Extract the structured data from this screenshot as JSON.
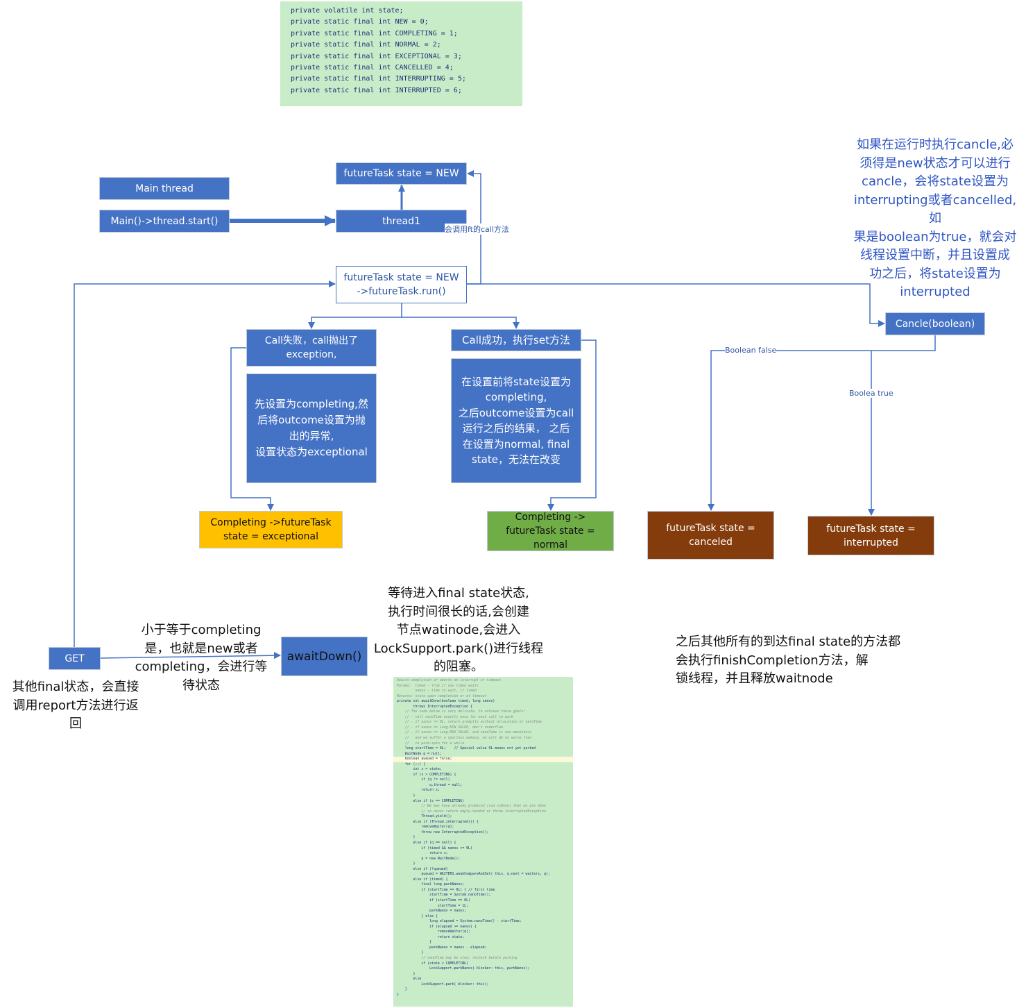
{
  "colors": {
    "blue": "#4472c4",
    "exceptional": "#ffc000",
    "normal": "#70ad47",
    "brown": "#843c0c",
    "code_bg": "#c8ecc8"
  },
  "state_code": [
    "private volatile int state;",
    "private static final int NEW = 0;",
    "private static final int COMPLETING = 1;",
    "private static final int NORMAL = 2;",
    "private static final int EXCEPTIONAL = 3;",
    "private static final int CANCELLED = 4;",
    "private static final int INTERRUPTING = 5;",
    "private static final int INTERRUPTED = 6;"
  ],
  "nodes": {
    "main_thread": "Main thread",
    "main_start": "Main()->thread.start()",
    "ft_new": "futureTask  state = NEW",
    "thread1": "thread1",
    "ft_run": "futureTask  state = NEW\n->futureTask.run()",
    "call_fail": "Call失败，call抛出了\nexception,",
    "call_fail_detail": "先设置为completing,然\n后将outcome设置为抛\n出的异常,\n设置状态为exceptional",
    "call_success": "Call成功，执行set方法",
    "call_success_detail": "在设置前将state设置为\ncompleting,\n之后outcome设置为call\n运行之后的结果， 之后\n在设置为normal, final\nstate，无法在改变",
    "exceptional": "Completing ->futureTask\nstate = exceptional",
    "normal": "Completing ->\nfutureTask state =\nnormal",
    "cancle": "Cancle(boolean)",
    "canceled": "futureTask state =\ncanceled",
    "interrupted": "futureTask state =\ninterrupted",
    "get": "GET",
    "await": "awaitDown()"
  },
  "edge_labels": {
    "call_method": "会调用ft的call方法",
    "bool_false": "Boolean false",
    "bool_true": "Boolea true"
  },
  "notes": {
    "cancel_note": "如果在运行时执行cancle,必\n须得是new状态才可以进行\ncancle，会将state设置为\ninterrupting或者cancelled,如\n果是boolean为true，就会对\n线程设置中断，并且设置成\n功之后，将state设置为\ninterrupted",
    "wait_note": "小于等于completing\n是，也就是new或者\ncompleting，会进行等\n待状态",
    "report_note": "其他final状态，会直接\n调用report方法进行返\n回",
    "park_note": "等待进入final state状态,\n执行时间很长的话,会创建\n节点watinode,会进入\nLockSupport.park()进行线程\n的阻塞。",
    "finish_note": "之后其他所有的到达final state的方法都\n会执行finishCompletion方法，解\n锁线程，并且释放waitnode"
  },
  "await_code": [
    {
      "t": "Awaits completion or aborts on interrupt or timeout.",
      "c": "cm"
    },
    {
      "t": "Params:  timed - true if use timed waits",
      "c": "cm"
    },
    {
      "t": "         nanos - time to wait, if timed",
      "c": "cm"
    },
    {
      "t": "Returns: state upon completion or at timeout",
      "c": "cm"
    },
    {
      "t": "private int awaitDone(boolean timed, long nanos)"
    },
    {
      "t": "        throws InterruptedException {"
    },
    {
      "t": "    // The code below is very delicate, to achieve these goals:",
      "c": "cm"
    },
    {
      "t": "    // - call nanoTime exactly once for each call to park",
      "c": "cm"
    },
    {
      "t": "    // - if nanos <= 0L, return promptly without allocation or nanoTime",
      "c": "cm"
    },
    {
      "t": "    // - if nanos == Long.MIN_VALUE, don't underflow",
      "c": "cm"
    },
    {
      "t": "    // - if nanos == Long.MAX_VALUE, and nanoTime is non-monotonic",
      "c": "cm"
    },
    {
      "t": "    //   and we suffer a spurious wakeup, we will do no worse than",
      "c": "cm"
    },
    {
      "t": "    //   to park-spin for a while",
      "c": "cm"
    },
    {
      "t": "    long startTime = 0L;    // Special value 0L means not yet parked"
    },
    {
      "t": "    WaitNode q = null;"
    },
    {
      "t": "    boolean queued = false;",
      "c": "hl"
    },
    {
      "t": "    for (;;) {"
    },
    {
      "t": "        int s = state;"
    },
    {
      "t": "        if (s > COMPLETING) {"
    },
    {
      "t": "            if (q != null)"
    },
    {
      "t": "                q.thread = null;"
    },
    {
      "t": "            return s;"
    },
    {
      "t": "        }"
    },
    {
      "t": "        else if (s == COMPLETING)"
    },
    {
      "t": "            // We may have already promised (via isDone) that we are done",
      "c": "cm"
    },
    {
      "t": "            // so never return empty-handed or throw InterruptedException",
      "c": "cm"
    },
    {
      "t": "            Thread.yield();"
    },
    {
      "t": "        else if (Thread.interrupted()) {"
    },
    {
      "t": "            removeWaiter(q);"
    },
    {
      "t": "            throw new InterruptedException();"
    },
    {
      "t": "        }"
    },
    {
      "t": "        else if (q == null) {"
    },
    {
      "t": "            if (timed && nanos <= 0L)"
    },
    {
      "t": "                return s;"
    },
    {
      "t": "            q = new WaitNode();"
    },
    {
      "t": "        }"
    },
    {
      "t": "        else if (!queued)"
    },
    {
      "t": "            queued = WAITERS.weakCompareAndSet( this, q.next = waiters, q);"
    },
    {
      "t": "        else if (timed) {"
    },
    {
      "t": "            final long parkNanos;"
    },
    {
      "t": "            if (startTime == 0L) { // first time"
    },
    {
      "t": "                startTime = System.nanoTime();"
    },
    {
      "t": "                if (startTime == 0L)"
    },
    {
      "t": "                    startTime = 1L;"
    },
    {
      "t": "                parkNanos = nanos;"
    },
    {
      "t": "            } else {"
    },
    {
      "t": "                long elapsed = System.nanoTime() - startTime;"
    },
    {
      "t": "                if (elapsed >= nanos) {"
    },
    {
      "t": "                    removeWaiter(q);"
    },
    {
      "t": "                    return state;"
    },
    {
      "t": "                }"
    },
    {
      "t": "                parkNanos = nanos - elapsed;"
    },
    {
      "t": "            }"
    },
    {
      "t": "            // nanoTime may be slow; recheck before parking",
      "c": "cm"
    },
    {
      "t": "            if (state < COMPLETING)"
    },
    {
      "t": "                LockSupport.parkNanos( blocker: this, parkNanos);"
    },
    {
      "t": "        }"
    },
    {
      "t": "        else"
    },
    {
      "t": "            LockSupport.park( blocker: this);"
    },
    {
      "t": "    }"
    },
    {
      "t": "}"
    }
  ]
}
